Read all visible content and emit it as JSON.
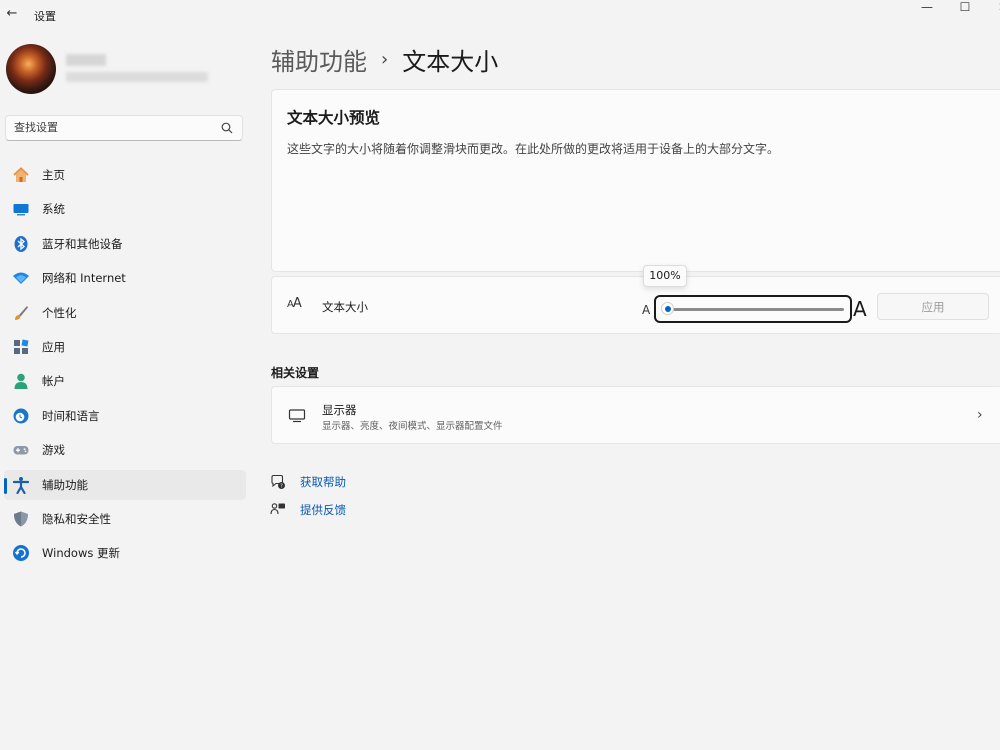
{
  "window": {
    "title": "设置",
    "back_glyph": "←",
    "minimize_glyph": "—",
    "maximize_glyph": "☐",
    "close_glyph": "✕"
  },
  "search": {
    "placeholder": "查找设置",
    "icon": "search-icon"
  },
  "sidebar": {
    "items": [
      {
        "label": "主页",
        "icon": "home-icon"
      },
      {
        "label": "系统",
        "icon": "system-icon"
      },
      {
        "label": "蓝牙和其他设备",
        "icon": "bluetooth-icon"
      },
      {
        "label": "网络和 Internet",
        "icon": "wifi-icon"
      },
      {
        "label": "个性化",
        "icon": "brush-icon"
      },
      {
        "label": "应用",
        "icon": "apps-icon"
      },
      {
        "label": "帐户",
        "icon": "account-icon"
      },
      {
        "label": "时间和语言",
        "icon": "globe-clock-icon"
      },
      {
        "label": "游戏",
        "icon": "gamepad-icon"
      },
      {
        "label": "辅助功能",
        "icon": "accessibility-icon",
        "active": true
      },
      {
        "label": "隐私和安全性",
        "icon": "shield-icon"
      },
      {
        "label": "Windows 更新",
        "icon": "update-icon"
      }
    ]
  },
  "header": {
    "parent": "辅助功能",
    "separator": "›",
    "current": "文本大小"
  },
  "preview": {
    "title": "文本大小预览",
    "text": "这些文字的大小将随着你调整滑块而更改。在此处所做的更改将适用于设备上的大部分文字。"
  },
  "text_size": {
    "icon_text": "A",
    "icon_text_large": "A",
    "label": "文本大小",
    "small_a": "A",
    "large_a": "A",
    "tooltip": "100%",
    "slider_value_fraction": 0.0,
    "apply_label": "应用"
  },
  "related": {
    "header": "相关设置",
    "display": {
      "title": "显示器",
      "subtitle": "显示器、亮度、夜间模式、显示器配置文件",
      "chevron": "›"
    }
  },
  "links": {
    "help": "获取帮助",
    "feedback": "提供反馈"
  },
  "colors": {
    "accent": "#0067c0",
    "background": "#f3f3f3",
    "card": "#fbfbfb",
    "link": "#0a58b3"
  }
}
